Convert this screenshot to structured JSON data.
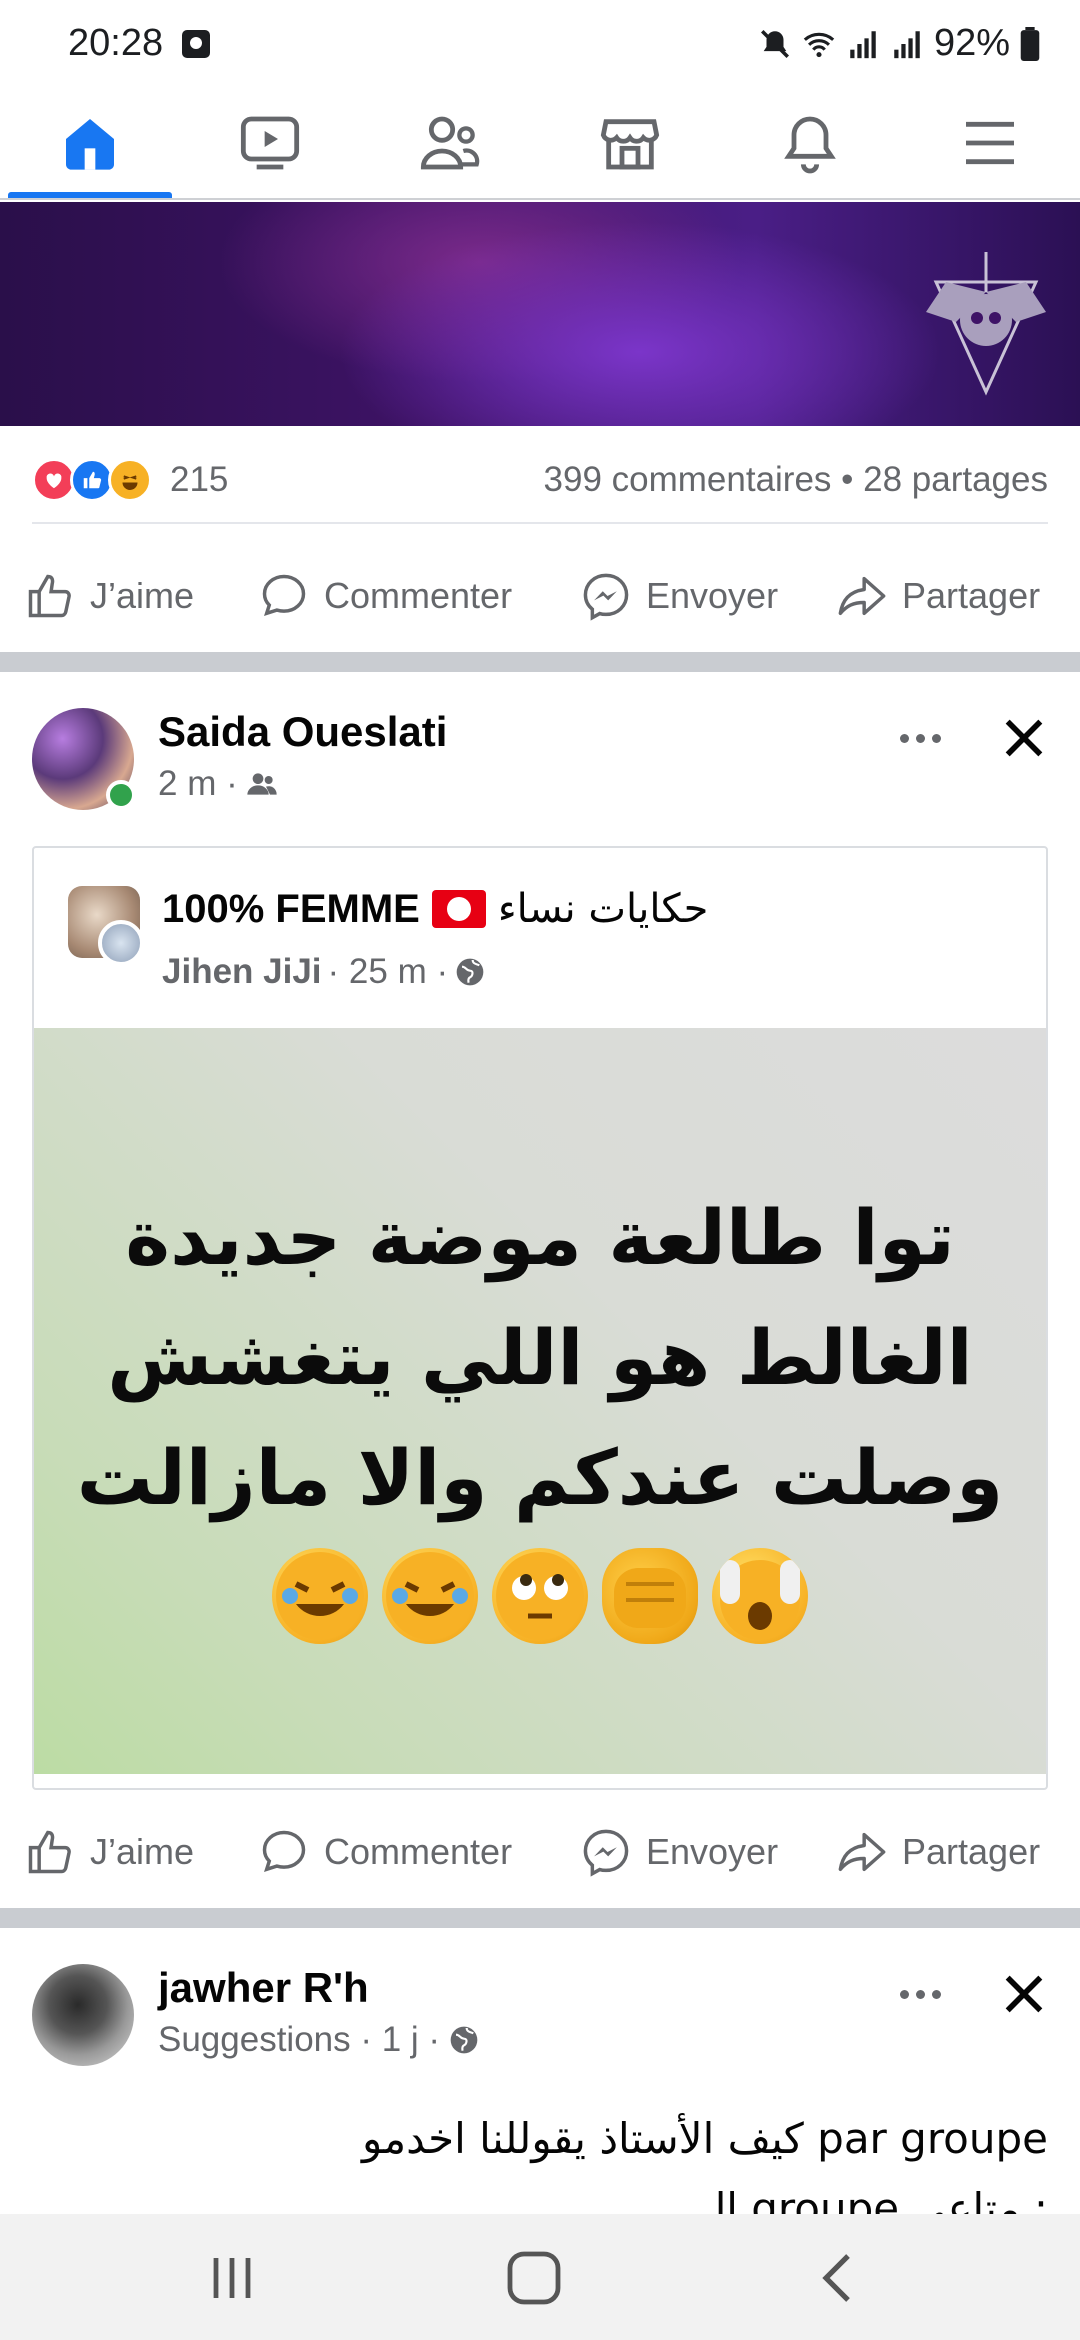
{
  "status_bar": {
    "time": "20:28",
    "battery": "92%",
    "icons": [
      "alarm-icon",
      "mute-icon",
      "wifi-icon",
      "signal-icon",
      "signal-icon",
      "battery-icon"
    ]
  },
  "nav": {
    "items": [
      "home-icon",
      "video-icon",
      "friends-icon",
      "marketplace-icon",
      "notifications-icon",
      "menu-icon"
    ],
    "active": "home",
    "accent_color": "#1877f2"
  },
  "post1": {
    "reactions_count": "215",
    "stats": "399 commentaires • 28 partages",
    "actions": {
      "like": "J’aime",
      "comment": "Commenter",
      "send": "Envoyer",
      "share": "Partager"
    }
  },
  "post2": {
    "author": "Saida Oueslati",
    "time": "2 m ·",
    "shared": {
      "group_name": "100% FEMME",
      "group_name_ar": "حكايات نساء",
      "poster": "Jihen JiJi",
      "time": "· 25 m ·",
      "image_lines": [
        "توا طالعة موضة جديدة",
        "الغالط هو اللي يتغشش",
        "وصلت عندكم والا مازالت"
      ],
      "emojis": [
        "rolling-laughing",
        "rolling-laughing",
        "eye-roll",
        "fist",
        "hands-over-face"
      ]
    },
    "actions": {
      "like": "J’aime",
      "comment": "Commenter",
      "send": "Envoyer",
      "share": "Partager"
    }
  },
  "post3": {
    "author": "jawher R'h",
    "meta": "Suggestions · 1 j ·",
    "text_line1": "كيف الأستاذ يقوللنا اخدمو par groupe",
    "text_line2": "ال groupe متاعي :"
  },
  "android_nav": [
    "recents-icon",
    "home-button-icon",
    "back-icon"
  ]
}
